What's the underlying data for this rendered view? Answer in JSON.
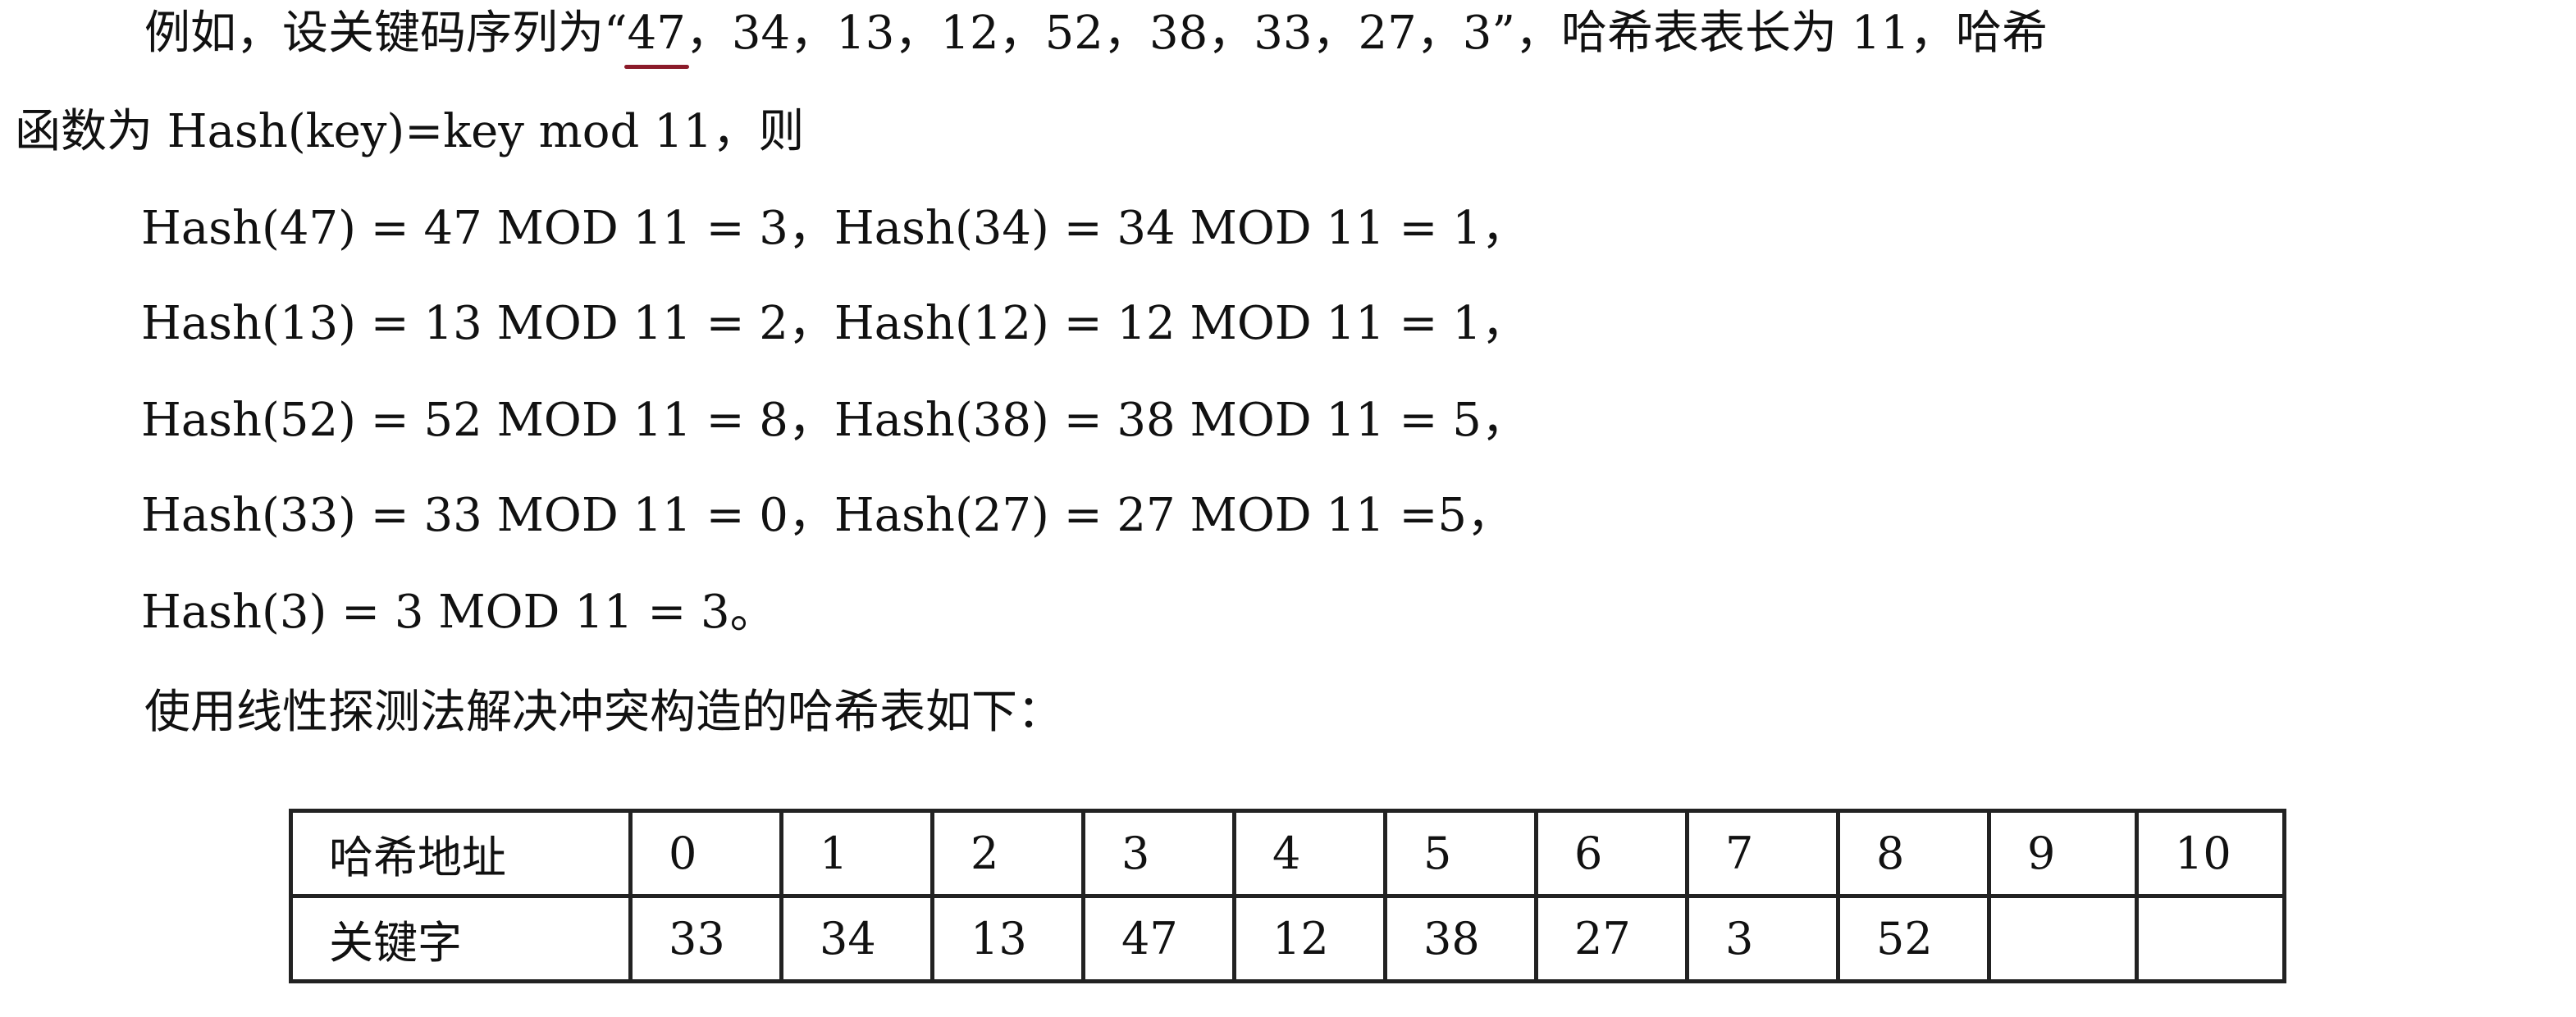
{
  "paragraph": {
    "line1_pre": "例如，设关键码序列为“",
    "line1_highlight": "47",
    "line1_post": "，34，13，12，52，38，33，27，3”，哈希表表长为 11，哈希",
    "line2": "函数为 Hash(key)=key mod 11，则"
  },
  "calculations": [
    "Hash(47) = 47 MOD 11 = 3，Hash(34) = 34 MOD 11 = 1，",
    "Hash(13) = 13 MOD 11 = 2，Hash(12) = 12 MOD 11 = 1，",
    "Hash(52) = 52 MOD 11 = 8，Hash(38) = 38 MOD 11 = 5，",
    "Hash(33) = 33 MOD 11 = 0，Hash(27) = 27 MOD 11 =5，",
    "Hash(3) = 3 MOD 11 = 3。"
  ],
  "closing": "使用线性探测法解决冲突构造的哈希表如下：",
  "table": {
    "address_label": "哈希地址",
    "key_label": "关键字",
    "addresses": [
      "0",
      "1",
      "2",
      "3",
      "4",
      "5",
      "6",
      "7",
      "8",
      "9",
      "10"
    ],
    "keys": [
      "33",
      "34",
      "13",
      "47",
      "12",
      "38",
      "27",
      "3",
      "52",
      "",
      ""
    ]
  },
  "colors": {
    "underline": "#8b1b2a"
  }
}
